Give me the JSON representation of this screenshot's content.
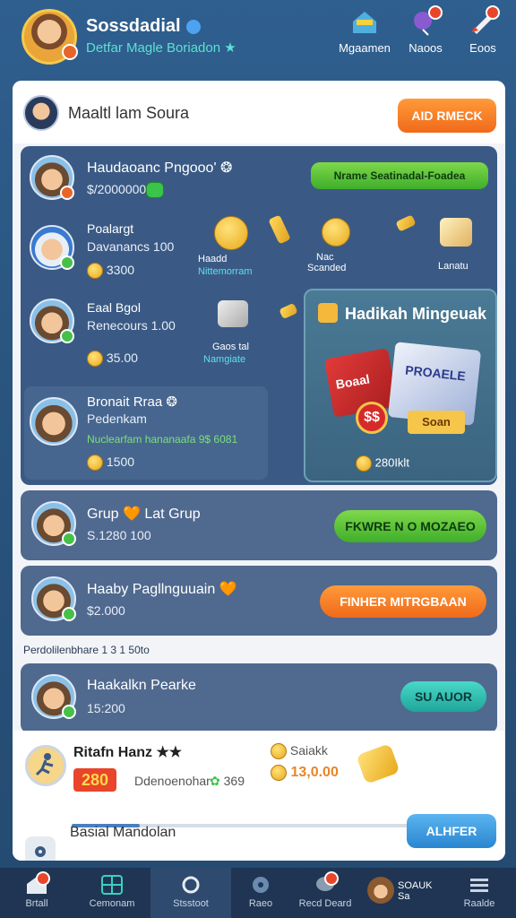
{
  "header": {
    "user_name": "Sossdadial",
    "subtitle": "Detfar Magle Boriadon ★",
    "nav": [
      {
        "label": "Mgaamen",
        "icon": "home-icon"
      },
      {
        "label": "Naoos",
        "icon": "balloon-icon"
      },
      {
        "label": "Eoos",
        "icon": "rocket-icon"
      }
    ]
  },
  "topbar": {
    "title": "Maaltl lam Soura",
    "action_label": "AID RMECK"
  },
  "rows": [
    {
      "name": "Haudaoanc Pngooo' ❂",
      "sub": "$/2000000",
      "action": "Nrame Seatinadal-Foadea"
    },
    {
      "name": "Poalargt",
      "sub": "Davanancs 100",
      "amount": "3300"
    },
    {
      "name": "Eaal Bgol",
      "sub": "Renecours 1.00",
      "amount": "35.00"
    },
    {
      "name": "Bronait Rraa ❂",
      "sub": "Pedenkam",
      "note": "Nuclearfam hananaafa 9$ 6081",
      "amount": "1500"
    }
  ],
  "items": [
    {
      "label": "Haadd",
      "sub": "Nittemorram"
    },
    {
      "label": "Nac",
      "sub": "Scanded"
    },
    {
      "label": "Lanatu"
    },
    {
      "label": "Gaos tal",
      "sub": "Namgiate"
    }
  ],
  "gift": {
    "title": "Hadikah Mingeuak",
    "box_label": "Boaal",
    "box2_label": "PROAELE",
    "price_tag": "$$",
    "coin_label": "Soan",
    "amount": "280Iklt"
  },
  "groups": [
    {
      "name": "Grup 🧡 Lat Grup",
      "sub": "S.1280 100",
      "action": "FKWRE N O MOZAEO"
    },
    {
      "name": "Haaby Pagllnguuain 🧡",
      "sub": "$2.000",
      "action": "FINHER MITRGBAAN"
    }
  ],
  "section_label": "Perdolilenbhare 1 3 1 50to",
  "last_row": {
    "name": "Haakalkn Pearke",
    "sub": "15:200",
    "action": "SU AUOR"
  },
  "bottom": {
    "name": "Ritafn Hanz ★★",
    "level": "280",
    "meta": "Ddenoenohar",
    "meta_count": "369",
    "coins_label": "Saiakk",
    "coins_value": "13,0.00",
    "progress": 0.16,
    "footer_text": "Basial Mandolan",
    "footer_action": "ALHFER"
  },
  "tabs": [
    {
      "label": "Brtall",
      "icon": "home-icon"
    },
    {
      "label": "Cemonam",
      "icon": "grid-icon"
    },
    {
      "label": "Stsstoot",
      "icon": "circle-icon"
    },
    {
      "label": "Raeo",
      "icon": "chat-icon"
    },
    {
      "label": "Recd Deard",
      "icon": "bubble-icon"
    },
    {
      "label": "SOAUK Sa",
      "icon": "avatar-icon"
    },
    {
      "label": "Raalde",
      "icon": "menu-icon"
    }
  ]
}
